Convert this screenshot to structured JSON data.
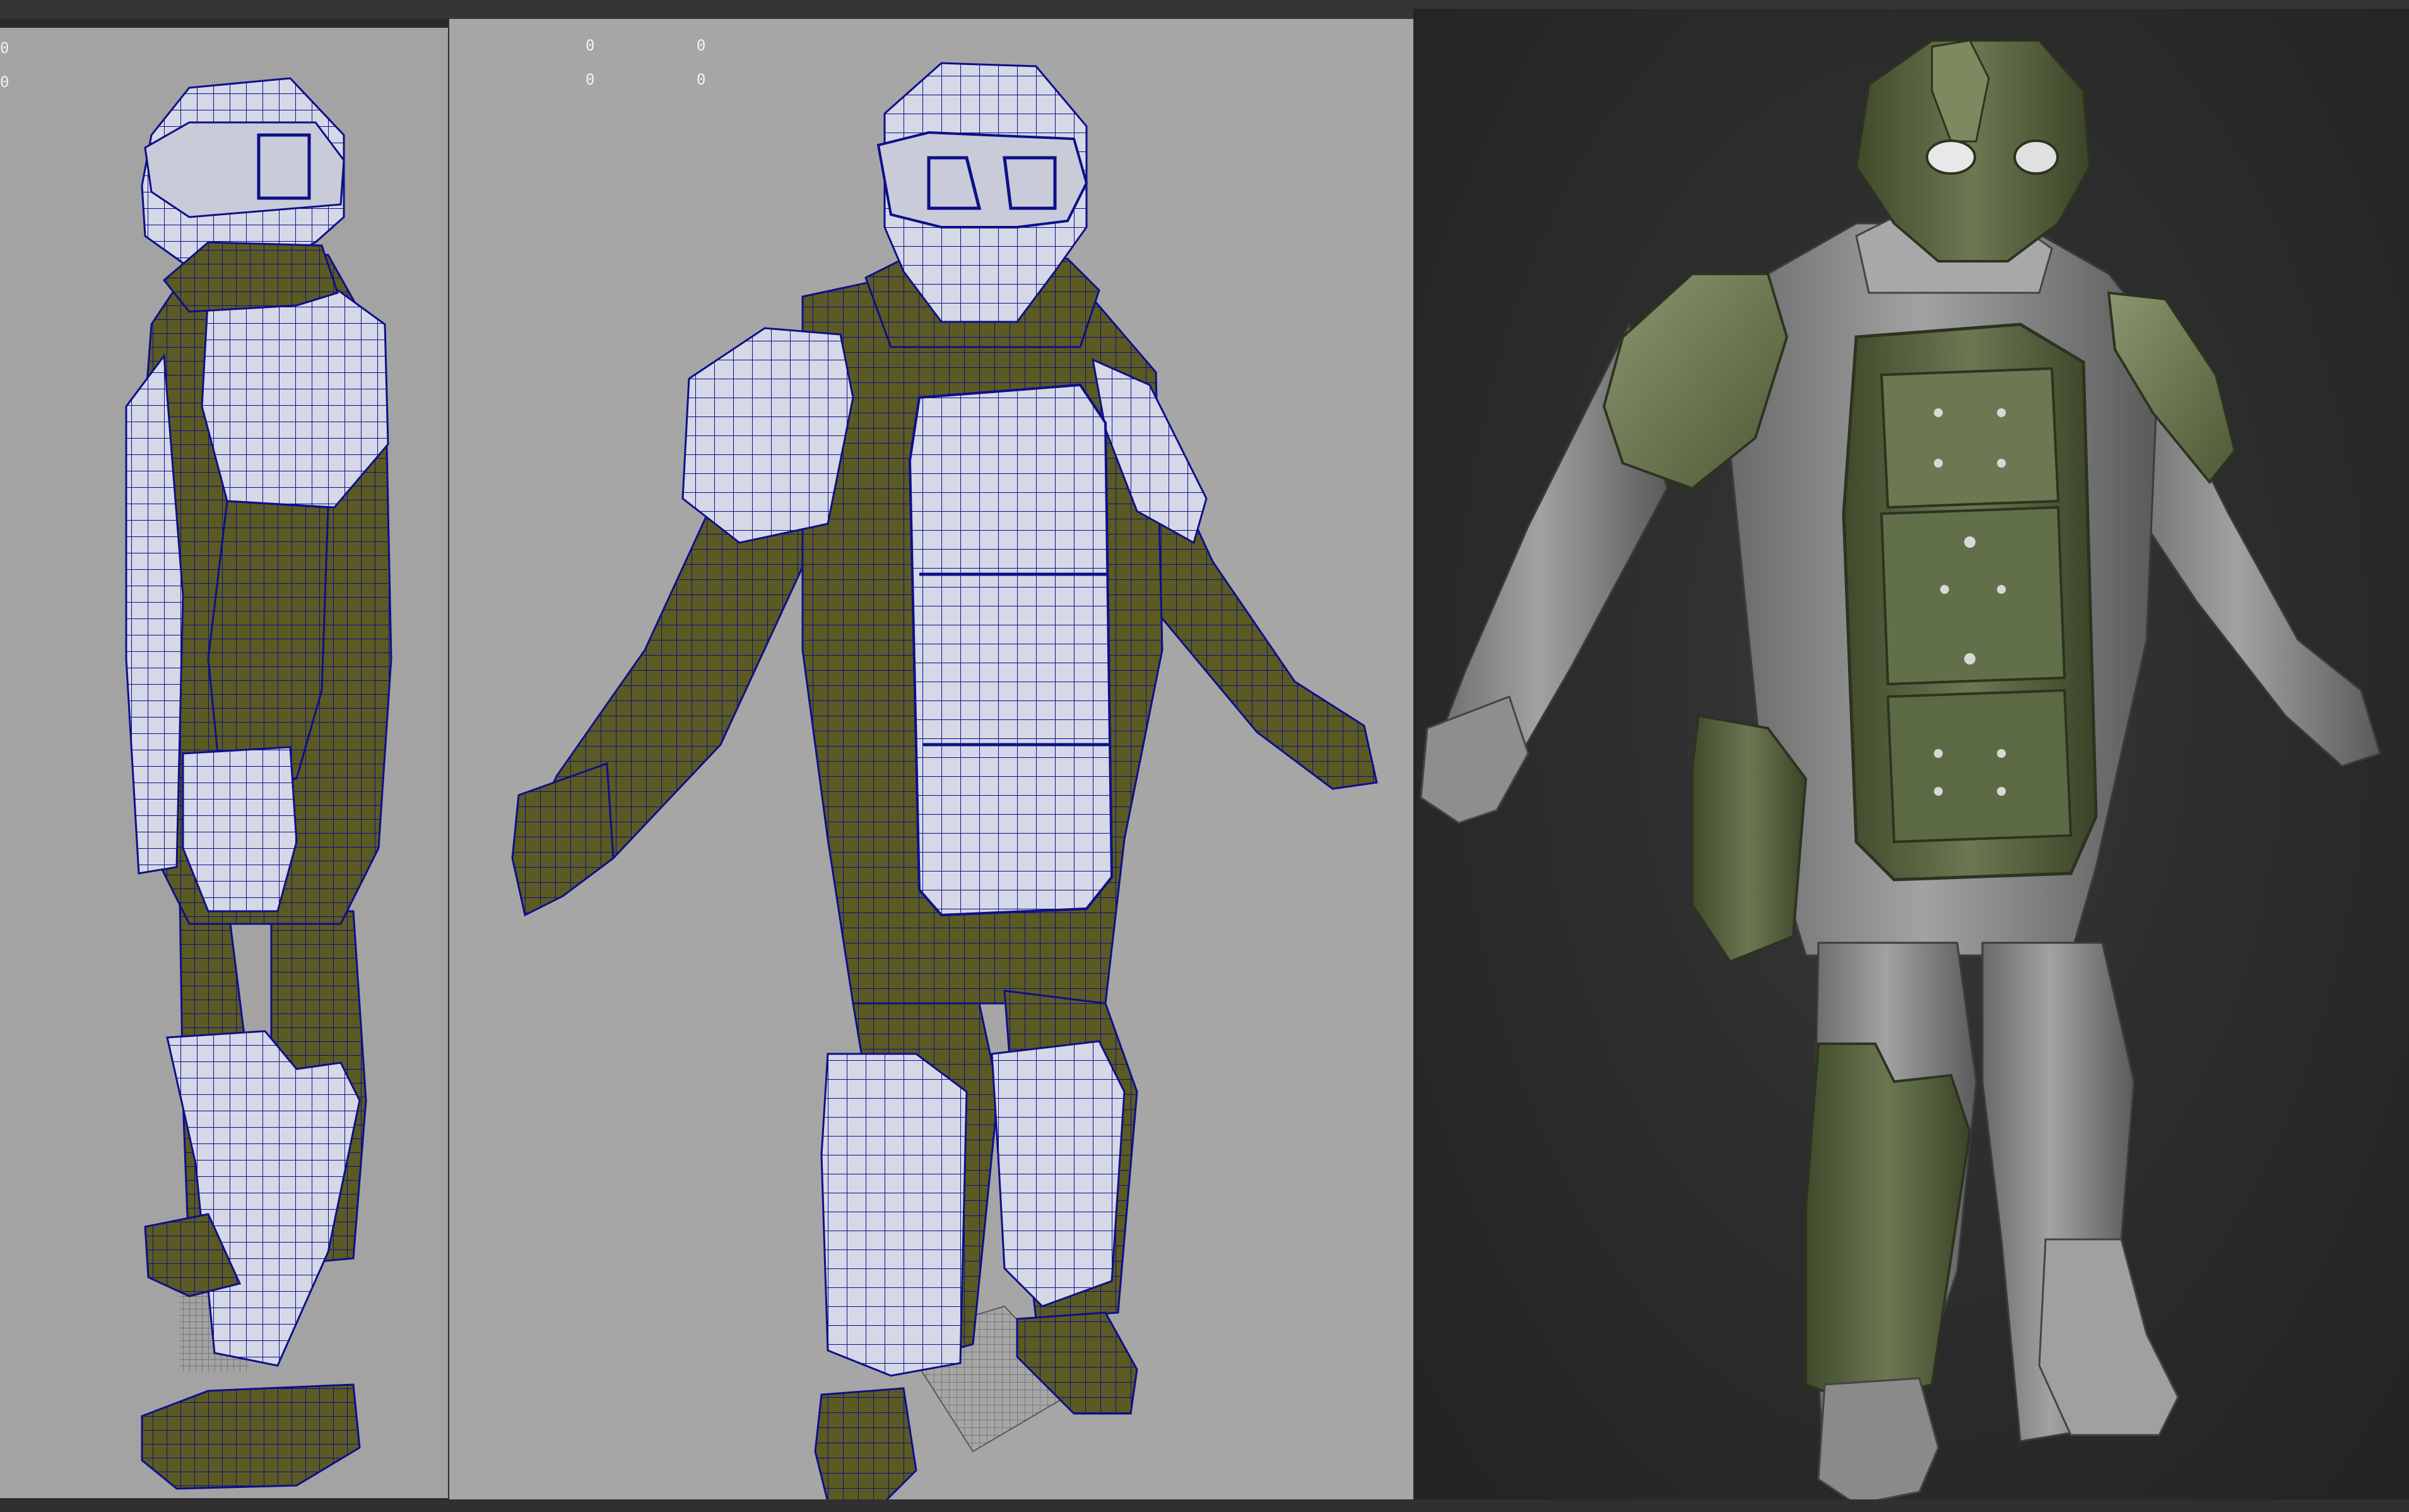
{
  "viewports": {
    "side": {
      "hud": [
        "0",
        "0"
      ]
    },
    "perspective": {
      "hud": {
        "row1": [
          "0",
          "0"
        ],
        "row2": [
          "0",
          "0"
        ]
      }
    }
  },
  "colors": {
    "background": "#2a2a2a",
    "viewport_gray": "#a6a6a6",
    "suit_olive": "#5b5a22",
    "armor_white": "#d5d8e6",
    "wire_blue": "#0d0f8a",
    "sculpt_green": "#5f6b47",
    "sculpt_gray": "#8e8e8e"
  },
  "models": {
    "side_view": "wireframe-soldier-side-icon",
    "perspective_view": "wireframe-soldier-front-icon",
    "sculpt_view": "sculpted-soldier-icon"
  }
}
